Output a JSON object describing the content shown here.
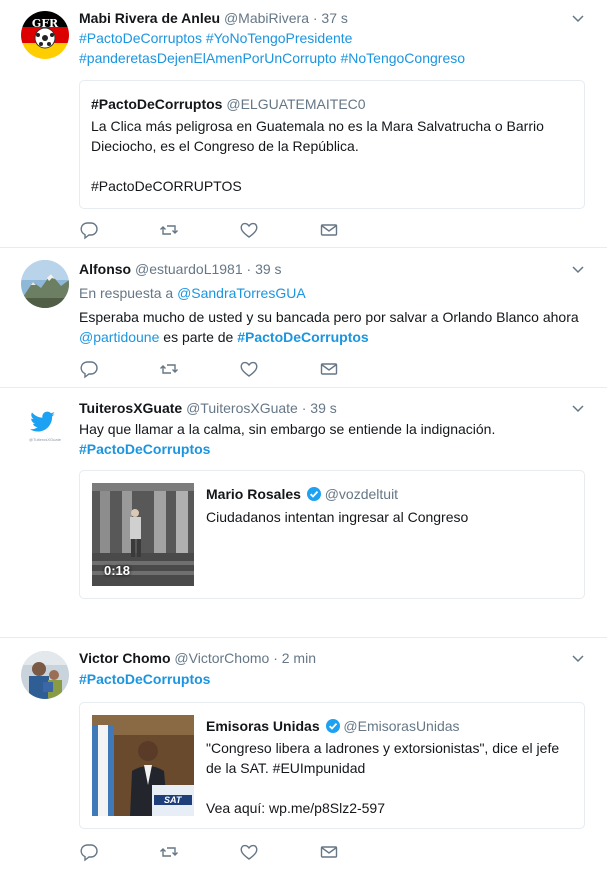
{
  "tweets": [
    {
      "name": "Mabi Rivera de Anleu",
      "handle": "@MabiRivera",
      "time": "· 37 s",
      "avatar_text": "GFR",
      "lines": [
        [
          "#PactoDeCorruptos",
          " ",
          "#YoNoTengoPresidente"
        ],
        [
          "#panderetasDejenElAmenPorUnCorrupto",
          " ",
          "#NoTengoCongreso"
        ]
      ],
      "quote": {
        "name": "#PactoDeCorruptos",
        "handle": "@ELGUATEMAITEC0",
        "line1": "La Clica más peligrosa en Guatemala no es la Mara Salvatrucha o Barrio",
        "line2": "Dieciocho, es el Congreso de la República.",
        "line3": "#PactoDeCORRUPTOS"
      }
    },
    {
      "name": "Alfonso",
      "handle": "@estuardoL1981",
      "time": "· 39 s",
      "reply_prefix": "En respuesta a",
      "reply_to": "@SandraTorresGUA",
      "line1": "Esperaba mucho de usted y su bancada pero por salvar a Orlando Blanco ahora",
      "line2_mention": "@partidoune",
      "line2_mid": " es parte de ",
      "line2_tag": "#PactoDeCorruptos"
    },
    {
      "name": "TuiterosXGuate",
      "handle": "@TuiterosXGuate",
      "time": "· 39 s",
      "avatar_caption": "@TuiterosXGuate",
      "line1": "Hay que llamar a la calma, sin embargo se entiende la indignación.",
      "line2_tag": "#PactoDeCorruptos",
      "quote": {
        "name": "Mario Rosales",
        "handle": "@vozdeltuit",
        "text": "Ciudadanos intentan ingresar al Congreso",
        "video_duration": "0:18"
      }
    },
    {
      "name": "Victor Chomo",
      "handle": "@VictorChomo",
      "time": "· 2 min",
      "line1_tag": "#PactoDeCorruptos",
      "quote": {
        "name": "Emisoras Unidas",
        "handle": "@EmisorasUnidas",
        "line1": "\"Congreso libera a ladrones y extorsionistas\", dice el jefe",
        "line2": "de la SAT. #EUImpunidad",
        "line3": "Vea aquí: wp.me/p8Slz2-597",
        "image_logo": "SAT"
      }
    }
  ],
  "colors": {
    "link": "#1b95e0",
    "secondary": "#657786",
    "border": "#e6ecf0",
    "verified": "#1da1f2"
  },
  "icons": [
    "reply-icon",
    "retweet-icon",
    "like-icon",
    "direct-message-icon",
    "chevron-down-icon",
    "verified-icon"
  ]
}
